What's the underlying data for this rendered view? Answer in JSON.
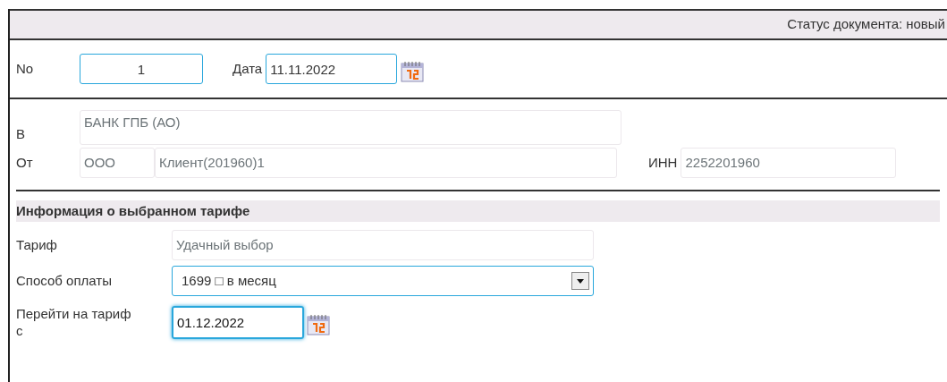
{
  "status": {
    "label": "Статус документа:",
    "value": "новый"
  },
  "number": {
    "label": "No",
    "value": "1"
  },
  "date": {
    "label": "Дата",
    "value": "11.11.2022"
  },
  "to": {
    "label": "В",
    "value": "БАНК ГПБ (АО)"
  },
  "from": {
    "label": "От",
    "form": "ООО",
    "name": "Клиент(201960)1"
  },
  "inn": {
    "label": "ИНН",
    "value": "2252201960"
  },
  "tariff_section": {
    "title": "Информация о выбранном тарифе",
    "tariff": {
      "label": "Тариф",
      "value": "Удачный выбор"
    },
    "payment": {
      "label": "Способ оплаты",
      "value": "1699 □ в месяц"
    },
    "switch_date": {
      "label": "Перейти на тариф с",
      "value": "01.12.2022",
      "focused": true
    }
  }
}
